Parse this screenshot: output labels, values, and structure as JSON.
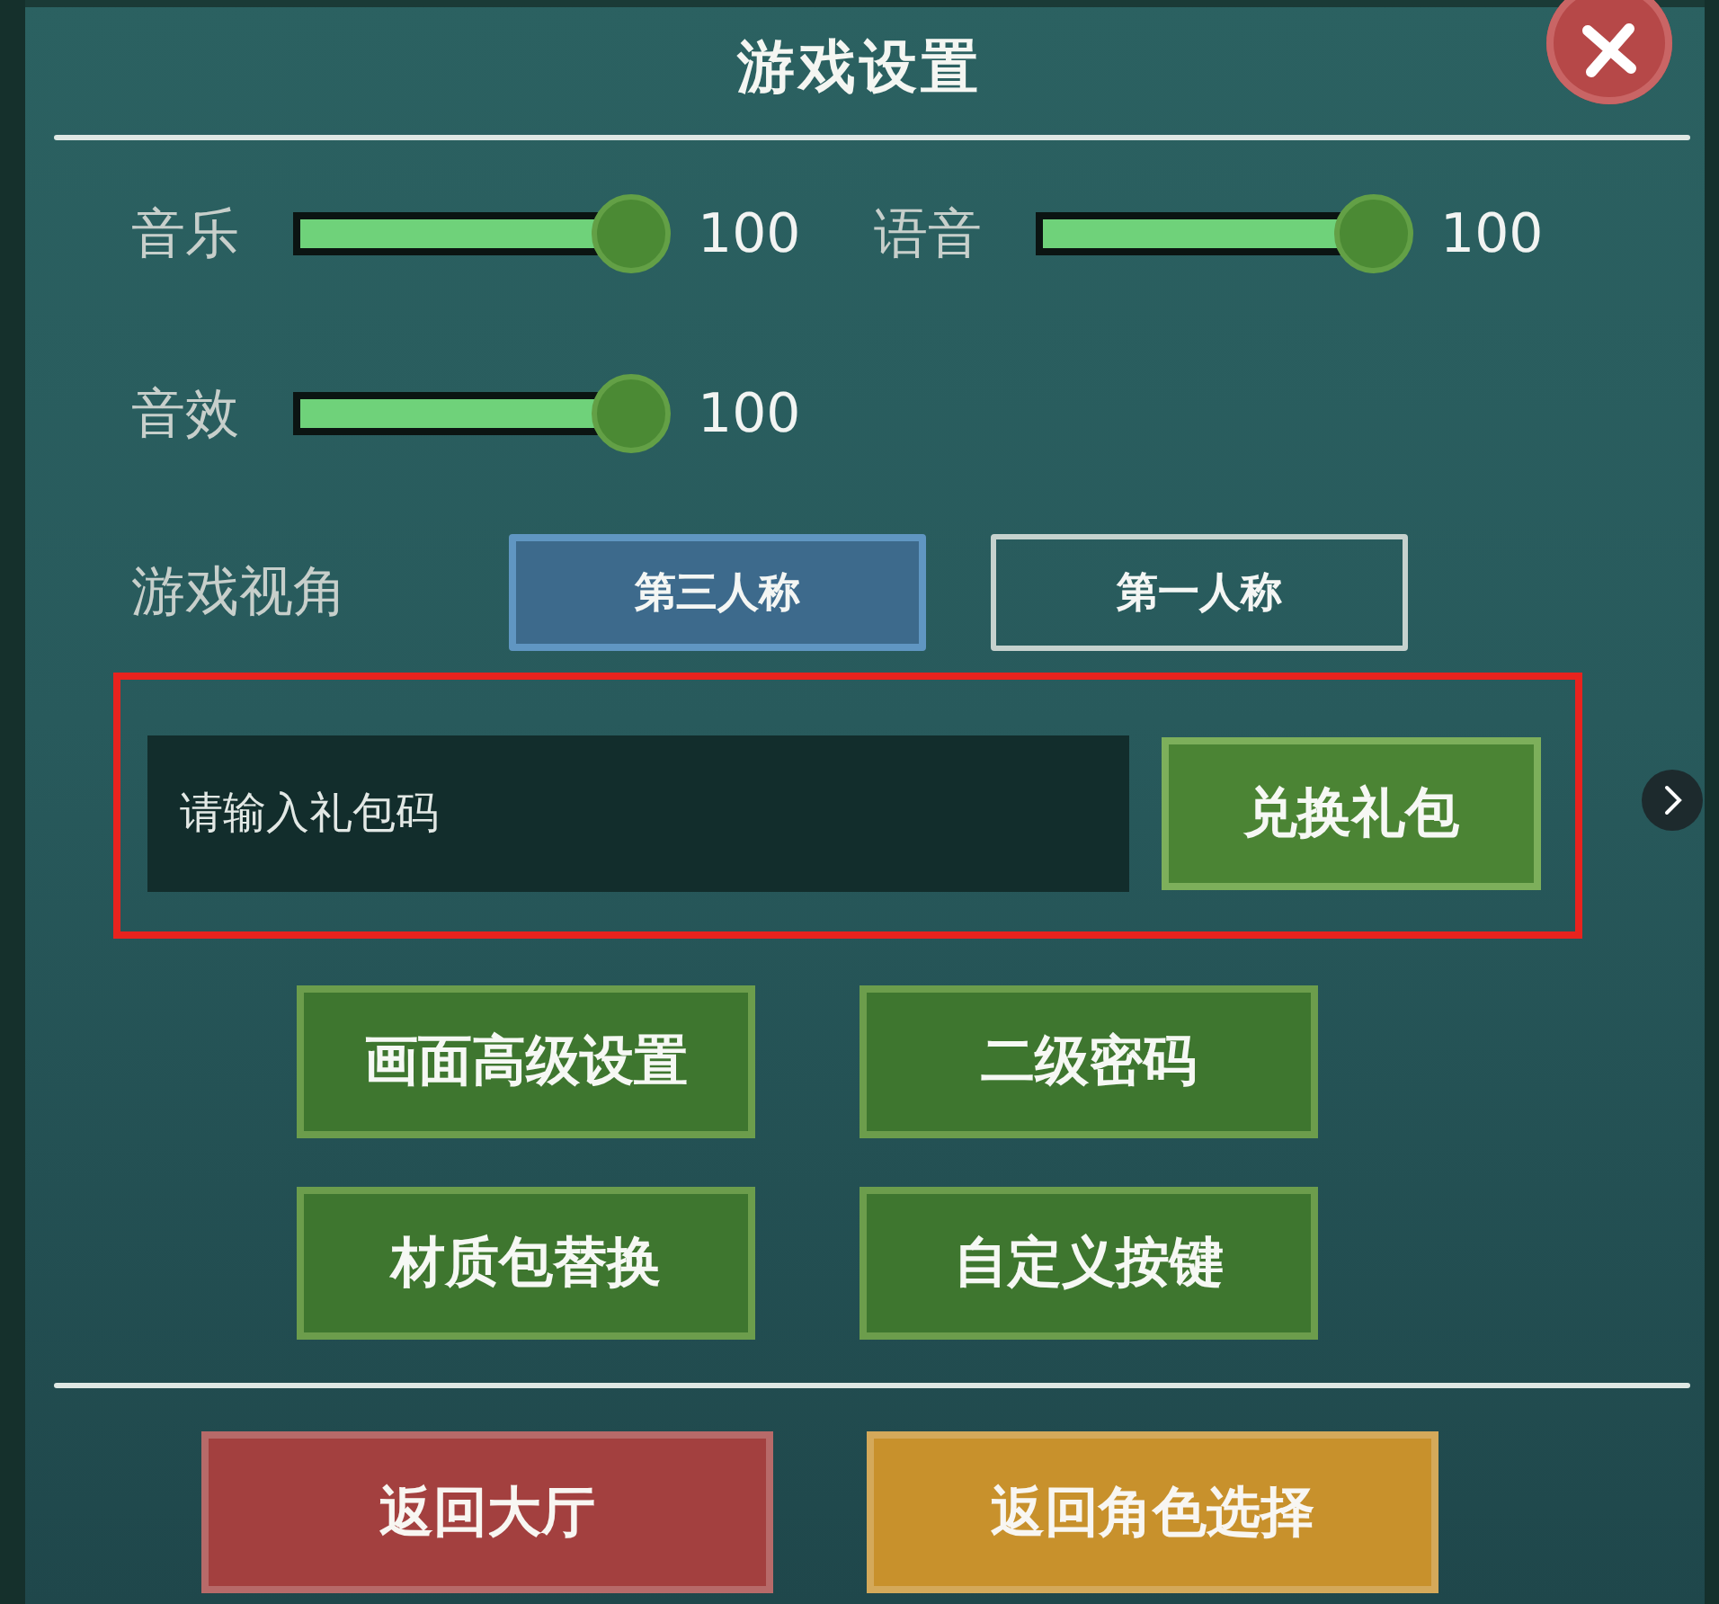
{
  "window": {
    "title": "游戏设置"
  },
  "volume": [
    {
      "label": "音乐",
      "level": 1,
      "reading": "100"
    },
    {
      "label": "语音",
      "level": 1,
      "reading": "100"
    },
    {
      "label": "音效",
      "level": 1,
      "reading": "100"
    }
  ],
  "view_angle": {
    "label": "游戏视角",
    "options": [
      {
        "label": "第三人称",
        "selected": true
      },
      {
        "label": "第一人称",
        "selected": false
      }
    ]
  },
  "gift_code": {
    "highlighted": true,
    "placeholder": "请输入礼包码",
    "button": "兑换礼包"
  },
  "buttons": [
    {
      "label": "画面高级设置"
    },
    {
      "label": "二级密码"
    },
    {
      "label": "材质包替换"
    },
    {
      "label": "自定义按键"
    }
  ],
  "footer_buttons": [
    {
      "label": "返回大厅",
      "color": "#a3403f"
    },
    {
      "label": "返回角色选择",
      "color": "#c8912c"
    }
  ]
}
